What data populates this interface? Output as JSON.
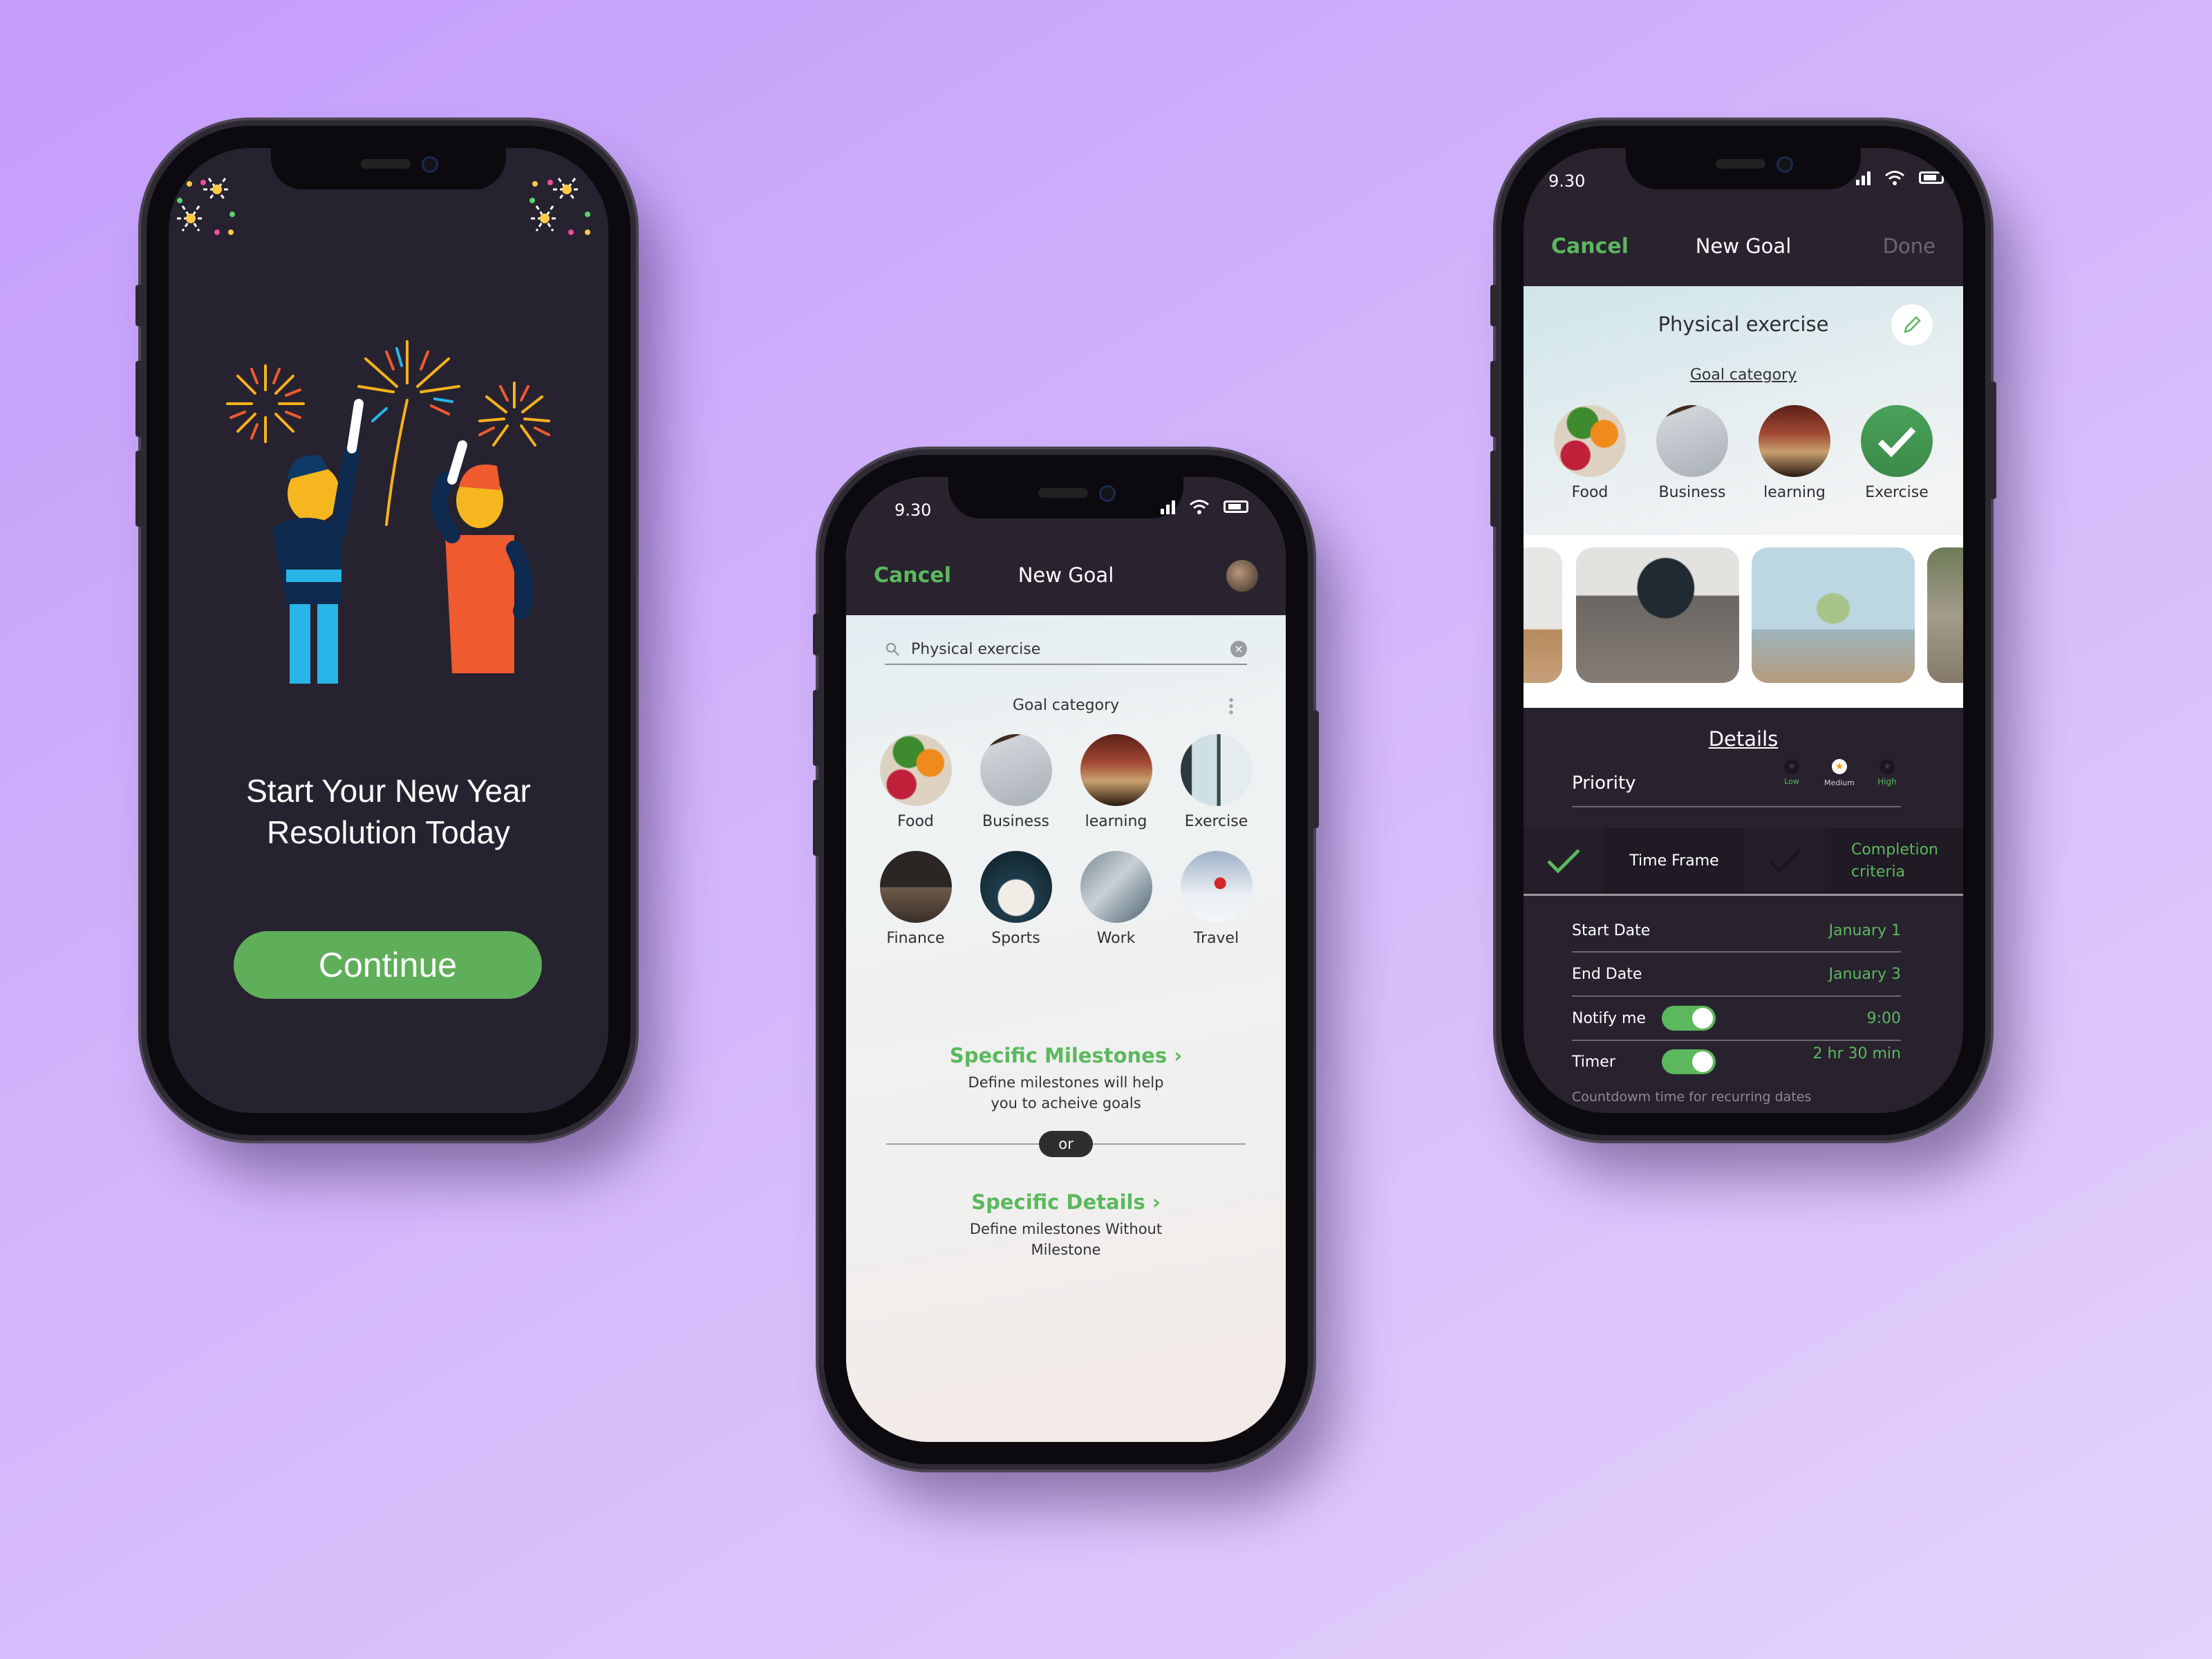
{
  "colors": {
    "accent": "#5bb85d",
    "dark_bg": "#27222f",
    "background_start": "#c49cfb",
    "background_end": "#e4d2fb",
    "star": "#ff9800"
  },
  "phone1": {
    "headline_line1": "Start Your New Year",
    "headline_line2": "Resolution Today",
    "continue_label": "Continue",
    "illustration": "two people toasting under fireworks"
  },
  "phone2": {
    "status": {
      "time": "9.30"
    },
    "nav": {
      "cancel": "Cancel",
      "title": "New Goal",
      "avatar": "profile-avatar"
    },
    "search": {
      "value": "Physical exercise",
      "placeholder": "Search"
    },
    "category_title": "Goal category",
    "categories": [
      {
        "label": "Food",
        "icon": "food-image"
      },
      {
        "label": "Business",
        "icon": "business-image"
      },
      {
        "label": "learning",
        "icon": "learning-image"
      },
      {
        "label": "Exercise",
        "icon": "exercise-image"
      },
      {
        "label": "Finance",
        "icon": "finance-image"
      },
      {
        "label": "Sports",
        "icon": "sports-image"
      },
      {
        "label": "Work",
        "icon": "work-image"
      },
      {
        "label": "Travel",
        "icon": "travel-image"
      }
    ],
    "option1": {
      "title": "Specific Milestones",
      "chevron": "›",
      "desc_line1": "Define milestones will help",
      "desc_line2": "you to acheive goals"
    },
    "or_label": "or",
    "option2": {
      "title": "Specific Details",
      "chevron": "›",
      "desc_line1": "Define milestones Without",
      "desc_line2": "Milestone"
    }
  },
  "phone3": {
    "status": {
      "time": "9.30"
    },
    "nav": {
      "cancel": "Cancel",
      "title": "New Goal",
      "done": "Done"
    },
    "goal_title": "Physical exercise",
    "category_title": "Goal category",
    "categories": [
      {
        "label": "Food",
        "selected": false
      },
      {
        "label": "Business",
        "selected": false
      },
      {
        "label": "learning",
        "selected": false
      },
      {
        "label": "Exercise",
        "selected": true
      }
    ],
    "gallery": [
      "home workout photo",
      "push-up with dumbbells photo",
      "beach run photo",
      "cycling photo"
    ],
    "details_title": "Details",
    "priority": {
      "label": "Priority",
      "options": [
        "Low",
        "Medium",
        "High"
      ],
      "selected": "Medium"
    },
    "steps": [
      {
        "label": "Time Frame",
        "done": true
      },
      {
        "label": "Completion criteria",
        "done": false
      }
    ],
    "rows": [
      {
        "label": "Start Date",
        "value": "January 1"
      },
      {
        "label": "End Date",
        "value": "January 3"
      },
      {
        "label": "Notify me",
        "value": "9:00",
        "toggle": true
      },
      {
        "label": "Timer",
        "value": "2 hr 30 min",
        "toggle": true
      }
    ],
    "footnote": "Countdowm time for recurring dates"
  }
}
